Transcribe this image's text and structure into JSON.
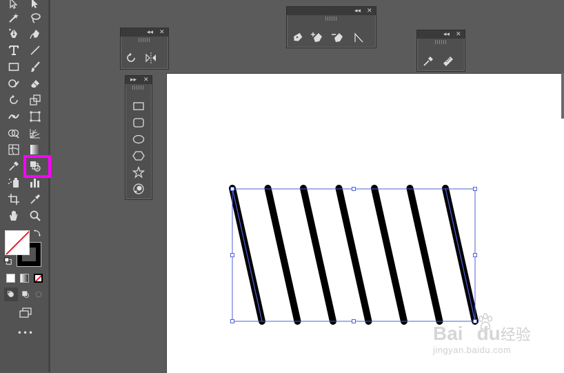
{
  "app": "Adobe Illustrator",
  "toolbar": {
    "tools": [
      {
        "name": "selection-tool",
        "icon": "arrow-icon"
      },
      {
        "name": "direct-selection-tool",
        "icon": "white-arrow-icon"
      },
      {
        "name": "magic-wand-tool",
        "icon": "magic-wand-icon"
      },
      {
        "name": "lasso-tool",
        "icon": "lasso-icon"
      },
      {
        "name": "pen-tool",
        "icon": "pen-icon"
      },
      {
        "name": "curvature-tool",
        "icon": "curvature-pen-icon"
      },
      {
        "name": "type-tool",
        "icon": "type-icon"
      },
      {
        "name": "line-tool",
        "icon": "line-icon"
      },
      {
        "name": "rectangle-tool",
        "icon": "rectangle-icon"
      },
      {
        "name": "paintbrush-tool",
        "icon": "brush-icon"
      },
      {
        "name": "shaper-tool",
        "icon": "shaper-icon"
      },
      {
        "name": "eraser-tool",
        "icon": "eraser-icon"
      },
      {
        "name": "rotate-tool",
        "icon": "rotate-icon"
      },
      {
        "name": "scale-tool",
        "icon": "scale-icon"
      },
      {
        "name": "width-tool",
        "icon": "width-icon"
      },
      {
        "name": "free-transform-tool",
        "icon": "free-transform-icon"
      },
      {
        "name": "shape-builder-tool",
        "icon": "shape-builder-icon"
      },
      {
        "name": "perspective-grid-tool",
        "icon": "perspective-grid-icon"
      },
      {
        "name": "mesh-tool",
        "icon": "mesh-icon"
      },
      {
        "name": "gradient-tool",
        "icon": "gradient-icon"
      },
      {
        "name": "eyedropper-tool",
        "icon": "eyedropper-icon"
      },
      {
        "name": "blend-tool",
        "icon": "blend-icon"
      },
      {
        "name": "symbol-sprayer-tool",
        "icon": "symbol-sprayer-icon"
      },
      {
        "name": "column-graph-tool",
        "icon": "column-graph-icon"
      },
      {
        "name": "artboard-tool",
        "icon": "artboard-icon"
      },
      {
        "name": "slice-tool",
        "icon": "slice-icon"
      },
      {
        "name": "hand-tool",
        "icon": "hand-icon"
      },
      {
        "name": "zoom-tool",
        "icon": "zoom-icon"
      }
    ],
    "highlighted_tool": "blend-tool",
    "highlight_color": "#ff00ff",
    "more_label": "•••"
  },
  "panels": {
    "transform": {
      "tools": [
        "rotate-icon",
        "reflect-icon"
      ]
    },
    "pen": {
      "tools": [
        "pen-icon",
        "add-anchor-point-icon",
        "delete-anchor-point-icon",
        "anchor-point-icon"
      ]
    },
    "eyedropper": {
      "tools": [
        "eyedropper-icon",
        "measure-icon"
      ]
    },
    "shapes": {
      "tools": [
        "rectangle-icon",
        "rounded-rectangle-icon",
        "ellipse-icon",
        "polygon-icon",
        "star-icon",
        "flare-icon"
      ]
    }
  },
  "canvas": {
    "artboard_color": "#ffffff",
    "stroke_count": 7,
    "stroke_color": "#000000",
    "selection_color": "#4d5fd6"
  },
  "watermark": {
    "brand": "Bai",
    "brand_mid": "du",
    "brand_cn": "经验",
    "url": "jingyan.baidu.com"
  }
}
